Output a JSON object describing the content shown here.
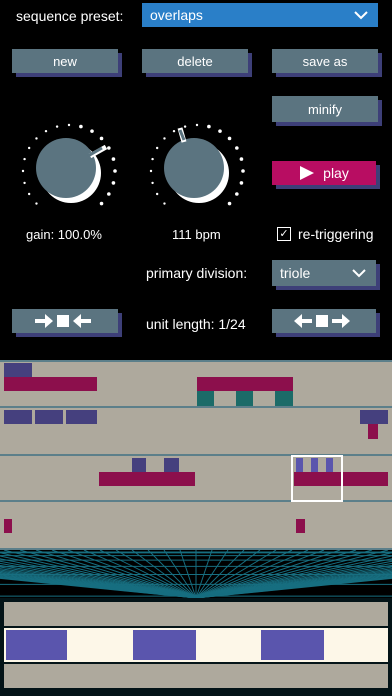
{
  "header": {
    "preset_label": "sequence preset:",
    "preset_value": "overlaps"
  },
  "buttons": {
    "new": "new",
    "delete": "delete",
    "save_as": "save as",
    "minify": "minify",
    "play": "play"
  },
  "knobs": {
    "gain_label": "gain: 100.0%",
    "gain_value": 1.0,
    "tempo_label": "111 bpm"
  },
  "retrigger": {
    "label": "re-triggering",
    "checked": true,
    "check_glyph": "✓"
  },
  "division": {
    "label": "primary division:",
    "value": "triole"
  },
  "unit_length": {
    "label": "unit length: 1/24"
  },
  "icons": {
    "expand": "arrows-inward-square-icon",
    "shrink": "arrows-outward-square-icon",
    "play": "play-triangle-icon",
    "dropdown": "chevron-down-icon"
  },
  "colors": {
    "button": "#5b7480",
    "button_shadow": "#3d3f78",
    "accent_blue": "#2a7fc8",
    "play": "#b80d62",
    "sequencer_bg": "#aea99d",
    "block_magenta": "#8c0f4c",
    "block_purple": "#45407e",
    "block_teal": "#1c6b68",
    "overview_purple": "#5a55ad",
    "overview_light": "#fdf7e8"
  }
}
